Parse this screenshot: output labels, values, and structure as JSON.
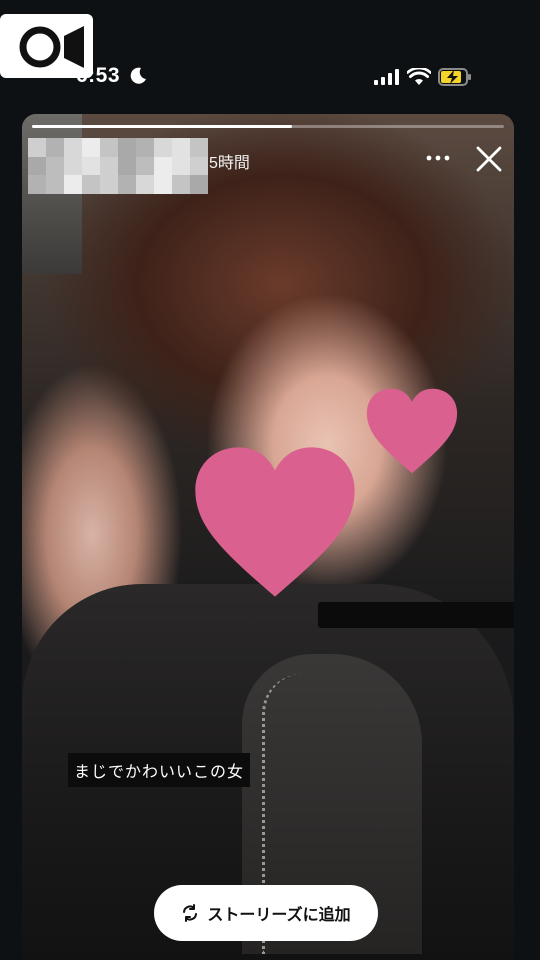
{
  "status_bar": {
    "time": "6:53"
  },
  "story": {
    "time_ago": "5時間",
    "progress": 0.55,
    "caption": "まじでかわいいこの女",
    "add_story_label": "ストーリーズに追加"
  },
  "colors": {
    "heart": "#d9608f",
    "button_bg": "#ffffff",
    "background": "#0e1114"
  }
}
